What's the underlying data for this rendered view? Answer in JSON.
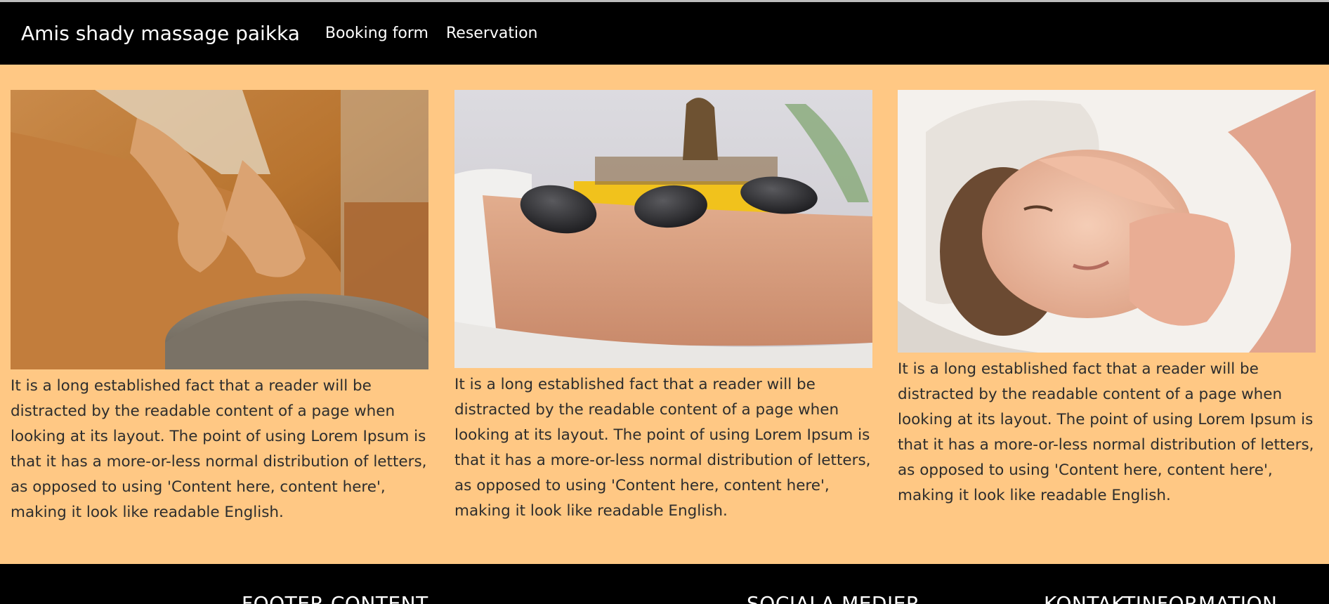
{
  "navbar": {
    "brand": "Amis shady massage paikka",
    "links": [
      "Booking form",
      "Reservation"
    ]
  },
  "cards": [
    {
      "image": "shoulder-massage-photo",
      "text": "It is a long established fact that a reader will be distracted by the readable content of a page when looking at its layout. The point of using Lorem Ipsum is that it has a more-or-less normal distribution of letters, as opposed to using 'Content here, content here', making it look like readable English."
    },
    {
      "image": "hot-stones-back-photo",
      "text": "It is a long established fact that a reader will be distracted by the readable content of a page when looking at its layout. The point of using Lorem Ipsum is that it has a more-or-less normal distribution of letters, as opposed to using 'Content here, content here', making it look like readable English."
    },
    {
      "image": "facial-massage-photo",
      "text": "It is a long established fact that a reader will be distracted by the readable content of a page when looking at its layout. The point of using Lorem Ipsum is that it has a more-or-less normal distribution of letters, as opposed to using 'Content here, content here', making it look like readable English."
    }
  ],
  "footer": {
    "headings": [
      "FOOTER CONTENT",
      "SOCIALA MEDIER",
      "KONTAKTINFORMATION"
    ]
  },
  "colors": {
    "page_bg": "#ffc884",
    "navbar_bg": "#000000",
    "text": "#2d2d2d"
  }
}
